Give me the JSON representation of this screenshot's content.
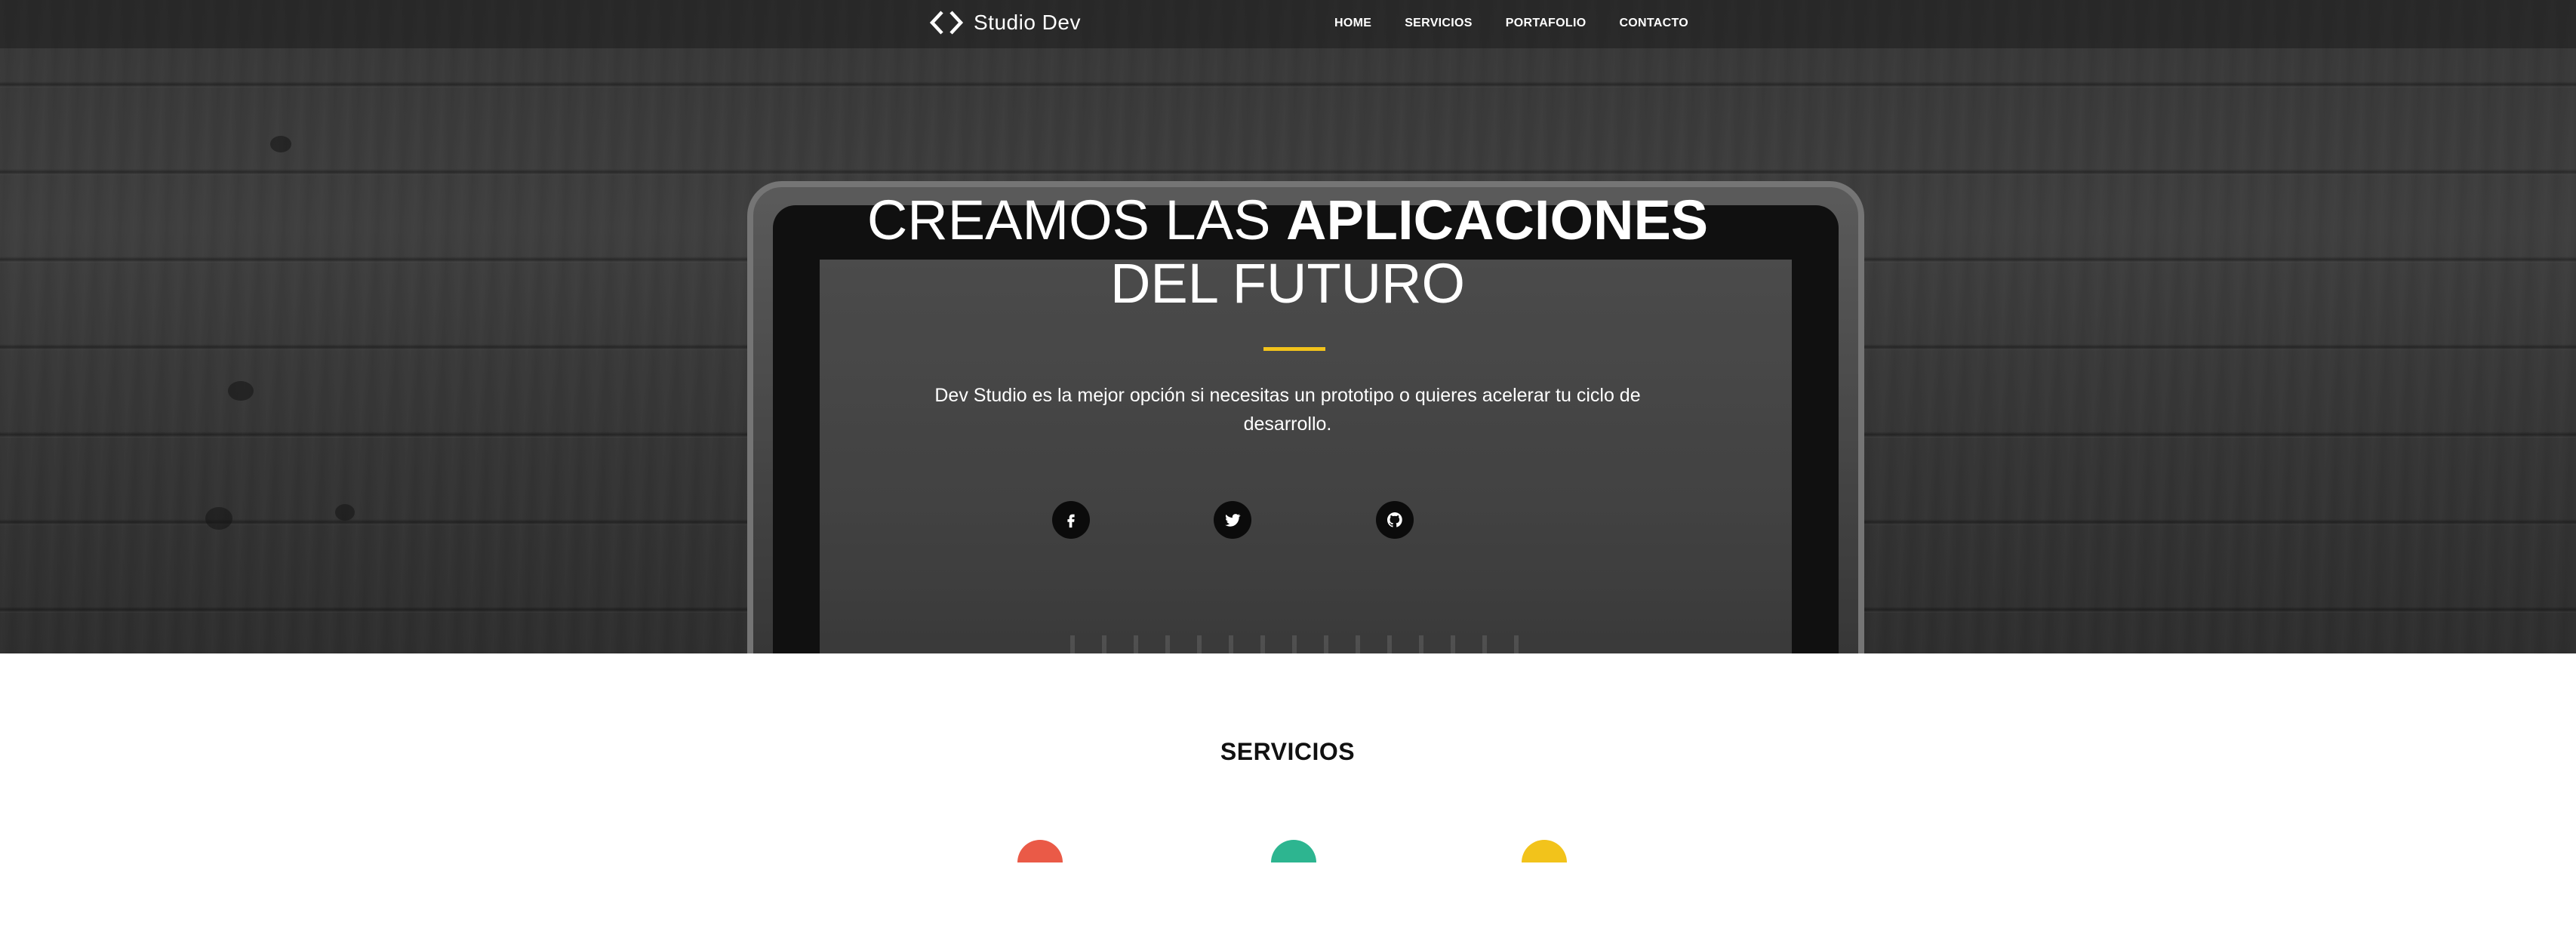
{
  "brand": {
    "name": "Studio Dev",
    "logo_icon": "code-brackets-icon"
  },
  "nav": {
    "items": [
      {
        "label": "HOME"
      },
      {
        "label": "SERVICIOS"
      },
      {
        "label": "PORTAFOLIO"
      },
      {
        "label": "CONTACTO"
      }
    ]
  },
  "hero": {
    "title_line1_prefix": "CREAMOS LAS ",
    "title_line1_bold": "APLICACIONES",
    "title_line2": "DEL FUTURO",
    "subtitle": "Dev Studio es la mejor opción si necesitas un prototipo o quieres acelerar tu ciclo de desarrollo.",
    "accent_color": "#f2c31b",
    "socials": [
      {
        "icon": "facebook-icon"
      },
      {
        "icon": "twitter-icon"
      },
      {
        "icon": "github-icon"
      }
    ]
  },
  "services": {
    "title": "SERVICIOS",
    "icon_colors": [
      "#ea5a47",
      "#2db590",
      "#f2c31b"
    ]
  }
}
